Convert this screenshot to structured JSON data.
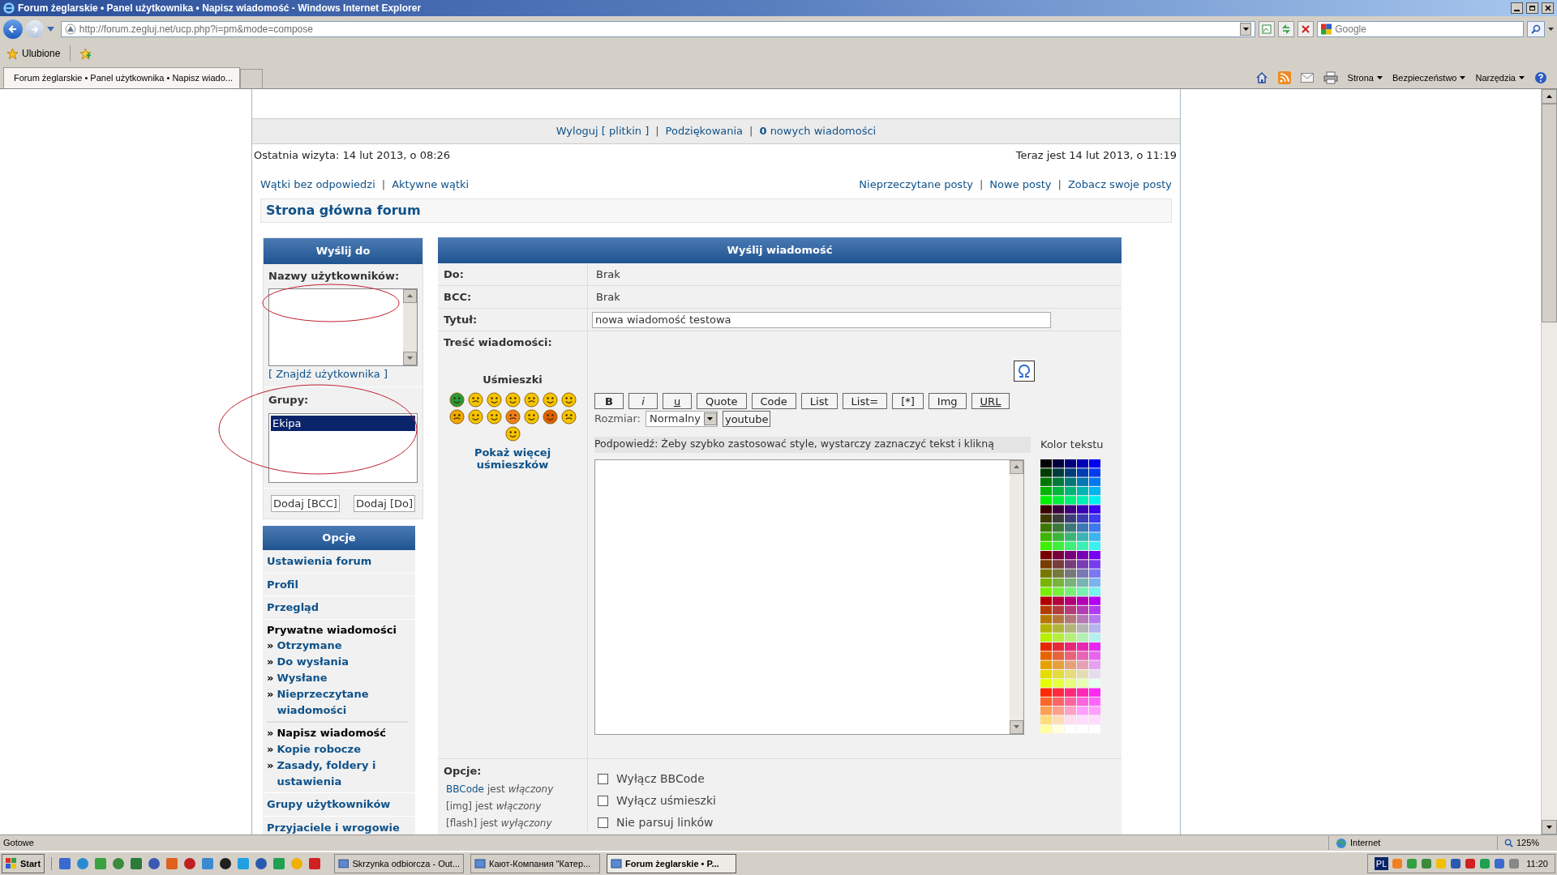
{
  "window": {
    "title": "Forum żeglarskie • Panel użytkownika • Napisz wiadomość - Windows Internet Explorer"
  },
  "address_bar": {
    "url": "http://forum.zegluj.net/ucp.php?i=pm&mode=compose"
  },
  "search": {
    "placeholder": "Google"
  },
  "favorites": {
    "label": "Ulubione"
  },
  "tabs": [
    {
      "label": "Forum żeglarskie • Panel użytkownika • Napisz wiado...",
      "selected": true
    }
  ],
  "command_bar": [
    "Strona",
    "Bezpieczeństwo",
    "Narzędzia"
  ],
  "top_nav": [
    {
      "kind": "link",
      "text": "Wyloguj [ plitkin ]"
    },
    {
      "kind": "separator",
      "text": "|"
    },
    {
      "kind": "link",
      "text": "Podziękowania"
    },
    {
      "kind": "separator",
      "text": "|"
    },
    {
      "kind": "link",
      "text": "**0** nowych wiadomości"
    }
  ],
  "last_visit": "Ostatnia wizyta: 14 lut 2013, o 08:26",
  "now": "Teraz jest 14 lut 2013, o 11:19",
  "links_left": [
    {
      "kind": "link",
      "text": "Wątki bez odpowiedzi"
    },
    {
      "kind": "separator",
      "text": "|"
    },
    {
      "kind": "link",
      "text": "Aktywne wątki"
    }
  ],
  "links_right": [
    {
      "kind": "link",
      "text": "Nieprzeczytane posty"
    },
    {
      "kind": "separator",
      "text": "|"
    },
    {
      "kind": "link",
      "text": "Nowe posty"
    },
    {
      "kind": "separator",
      "text": "|"
    },
    {
      "kind": "link",
      "text": "Zobacz swoje posty"
    }
  ],
  "breadcrumb": "Strona główna forum",
  "send_to": {
    "title": "Wyślij do",
    "usernames_label": "Nazwy użytkowników:",
    "find_user": "[ Znajdź użytkownika ]",
    "groups_label": "Grupy:",
    "groups": [
      {
        "label": "Ekipa",
        "selected": true
      }
    ],
    "buttons": [
      "Dodaj [BCC]",
      "Dodaj [Do]"
    ]
  },
  "options_menu": {
    "title": "Opcje",
    "items": [
      {
        "label": "Ustawienia forum",
        "kind": "link"
      },
      {
        "label": "Profil",
        "kind": "link"
      },
      {
        "label": "Przegląd",
        "kind": "link"
      },
      {
        "label": "Prywatne wiadomości",
        "kind": "section",
        "children": [
          {
            "bullet": "»",
            "label": "Otrzymane",
            "selected": false
          },
          {
            "bullet": "»",
            "label": "Do wysłania",
            "selected": false
          },
          {
            "bullet": "»",
            "label": "Wysłane",
            "selected": false
          },
          {
            "bullet": "»",
            "label": "Nieprzeczytane wiadomości",
            "selected": false
          },
          {
            "bullet": "»",
            "label": "Napisz wiadomość",
            "selected": true
          },
          {
            "bullet": "»",
            "label": "Kopie robocze",
            "selected": false
          },
          {
            "bullet": "»",
            "label": "Zasady, foldery i ustawienia",
            "selected": false
          }
        ]
      },
      {
        "label": "Grupy użytkowników",
        "kind": "link"
      },
      {
        "label": "Przyjaciele i wrogowie",
        "kind": "link"
      }
    ]
  },
  "message": {
    "title": "Wyślij wiadomość",
    "fields": [
      {
        "label": "Do:",
        "value": "Brak",
        "kind": "text"
      },
      {
        "label": "BCC:",
        "value": "Brak",
        "kind": "text"
      },
      {
        "label": "Tytuł:",
        "value": "nowa wiadomość testowa",
        "kind": "input"
      }
    ],
    "body_label": "Treść wiadomości:",
    "smileys_title": "Uśmieszki",
    "more_smileys": "Pokaż więcej uśmieszków",
    "toolbar": [
      {
        "label": "B",
        "kind": "bold"
      },
      {
        "label": "i",
        "kind": "italic"
      },
      {
        "label": "u",
        "kind": "underline"
      },
      {
        "label": "Quote",
        "kind": "plain"
      },
      {
        "label": "Code",
        "kind": "plain"
      },
      {
        "label": "List",
        "kind": "plain"
      },
      {
        "label": "List=",
        "kind": "plain"
      },
      {
        "label": "[*]",
        "kind": "plain"
      },
      {
        "label": "Img",
        "kind": "plain"
      },
      {
        "label": "URL",
        "kind": "underline"
      }
    ],
    "size_label": "Rozmiar:",
    "size_value": "Normalny",
    "youtube": "youtube",
    "hint": "Podpowiedź: Żeby szybko zastosować style, wystarczy zaznaczyć tekst i klikną",
    "color_label": "Kolor tekstu"
  },
  "options": {
    "label": "Opcje:",
    "status": [
      {
        "name": "BBCode",
        "link": true,
        "verb": "jest",
        "state": "włączony"
      },
      {
        "name": "[img]",
        "link": false,
        "verb": "jest",
        "state": "włączony"
      },
      {
        "name": "[flash]",
        "link": false,
        "verb": "jest",
        "state": "wyłączony"
      }
    ],
    "checkboxes": [
      {
        "label": "Wyłącz BBCode",
        "checked": false
      },
      {
        "label": "Wyłącz uśmieszki",
        "checked": false
      },
      {
        "label": "Nie parsuj linków",
        "checked": false
      }
    ]
  },
  "status_bar": {
    "text": "Gotowe",
    "zone": "Internet",
    "zoom": "125%"
  },
  "taskbar": {
    "start": "Start",
    "windows": [
      {
        "label": "Skrzynka odbiorcza - Out...",
        "selected": false
      },
      {
        "label": "Кают-Компания \"Катер...",
        "selected": false
      },
      {
        "label": "Forum żeglarskie • P...",
        "selected": true
      }
    ],
    "language": "PL",
    "clock": "11:20"
  }
}
